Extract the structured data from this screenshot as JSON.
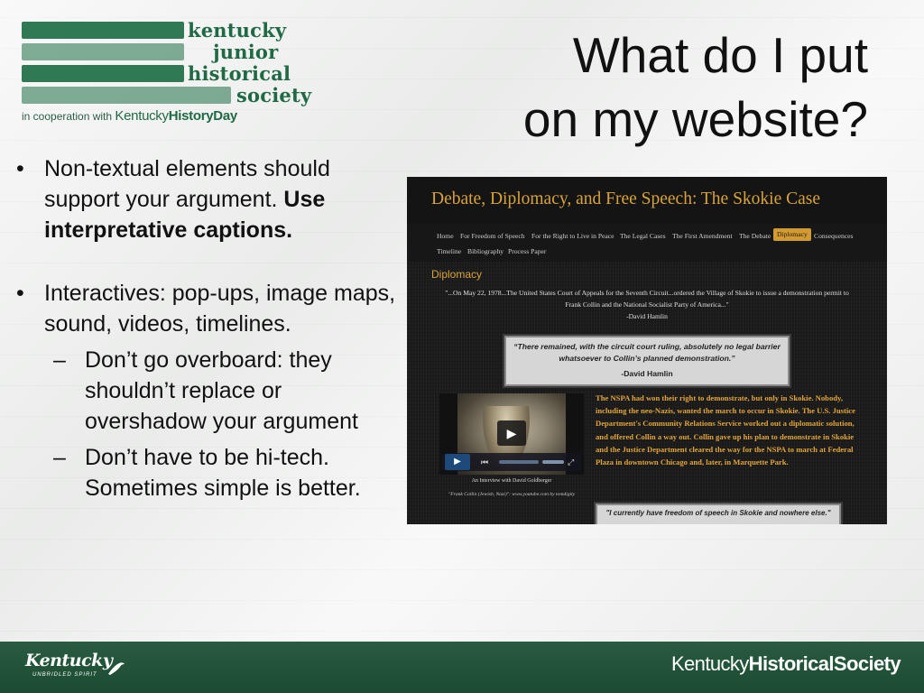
{
  "logo": {
    "line1": "kentucky",
    "line2": "junior",
    "line3": "historical",
    "line4": "society",
    "cooperation": "in cooperation with",
    "partner_light": "Kentucky",
    "partner_bold": "HistoryDay",
    "bar_color": "#2f7a54"
  },
  "title": {
    "line1": "What do I put",
    "line2": "on my website?"
  },
  "bullets": {
    "item1_plain": "Non-textual elements should support your argument. ",
    "item1_bold": "Use interpretative captions.",
    "item2": "Interactives: pop-ups, image maps, sound, videos, timelines.",
    "sub1": "Don’t go overboard: they shouldn’t replace or overshadow your argument",
    "sub2": "Don’t have to be hi-tech. Sometimes simple is better.",
    "bullet_glyph": "•",
    "dash_glyph": "–"
  },
  "website": {
    "title": "Debate, Diplomacy, and Free Speech: The Skokie Case",
    "nav": [
      "Home",
      "For Freedom of Speech",
      "For the Right to Live in Peace",
      "The Legal Cases",
      "The First Amendment",
      "The Debate",
      "Diplomacy",
      "Consequences",
      "Timeline",
      "Bibliography",
      "Process Paper"
    ],
    "active_nav": "Diplomacy",
    "heading": "Diplomacy",
    "quote_line1": "\"...On May 22, 1978...The United States Court of Appeals for the Seventh Circuit...ordered the Village of Skokie to issue a demonstration permit to",
    "quote_line2": "Frank Collin and the National Socialist Party of America...\"",
    "quote_attr": "-David Hamlin",
    "pull_quote": "“There remained, with the circuit court ruling, absolutely no legal barrier whatsoever to Collin’s planned demonstration.”",
    "pull_quote_attr": "-David Hamlin",
    "video_caption": "An Interview with David Goldberger",
    "video_credit": "\"Frank Collin (Jewish, Nazi)\": www.youtube.com by tomdigity",
    "story": "The NSPA had won their right to demonstrate, but only in Skokie. Nobody, including the neo-Nazis, wanted the march to occur in Skokie. The U.S. Justice Department's Community Relations Service worked out a diplomatic solution, and offered Collin a way out. Collin gave up his plan to demonstrate in Skokie and the Justice Department cleared the way for the NSPA to march at Federal Plaza in downtown Chicago and, later, in Marquette Park.",
    "pull_quote_2": "\"I currently have freedom of speech in Skokie and nowhere else.\"",
    "accent_color": "#d9a33a"
  },
  "footer": {
    "left_brand": "Kentucky",
    "left_tagline": "UNBRIDLED SPIRIT",
    "right_light": "Kentucky",
    "right_bold": "HistoricalSociety",
    "bg_color": "#1e5337"
  }
}
